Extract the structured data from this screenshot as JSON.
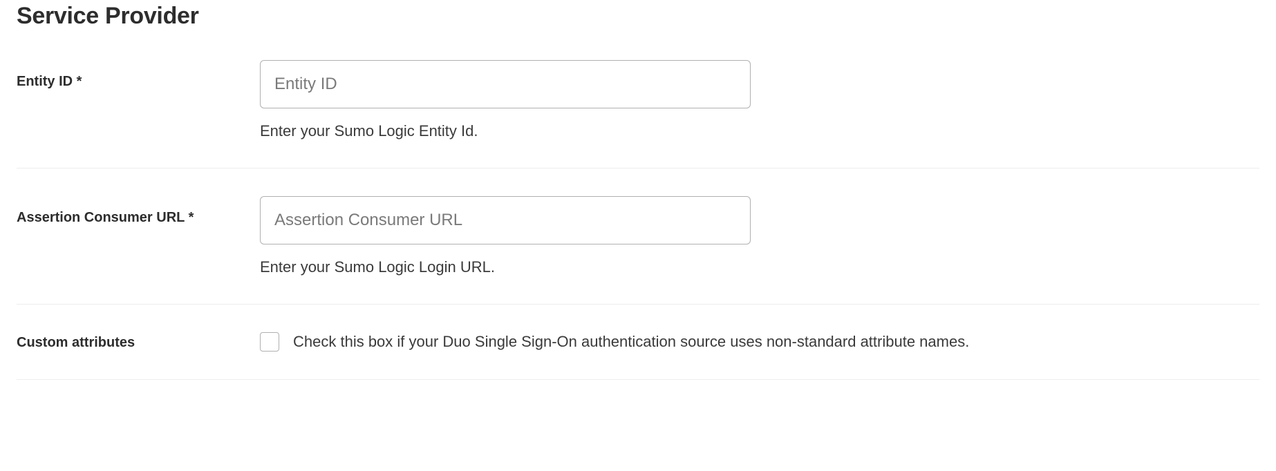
{
  "section": {
    "title": "Service Provider"
  },
  "fields": {
    "entity_id": {
      "label": "Entity ID *",
      "placeholder": "Entity ID",
      "value": "",
      "help": "Enter your Sumo Logic Entity Id."
    },
    "acs_url": {
      "label": "Assertion Consumer URL *",
      "placeholder": "Assertion Consumer URL",
      "value": "",
      "help": "Enter your Sumo Logic Login URL."
    },
    "custom_attributes": {
      "label": "Custom attributes",
      "checked": false,
      "description": "Check this box if your Duo Single Sign-On authentication source uses non-standard attribute names."
    }
  }
}
